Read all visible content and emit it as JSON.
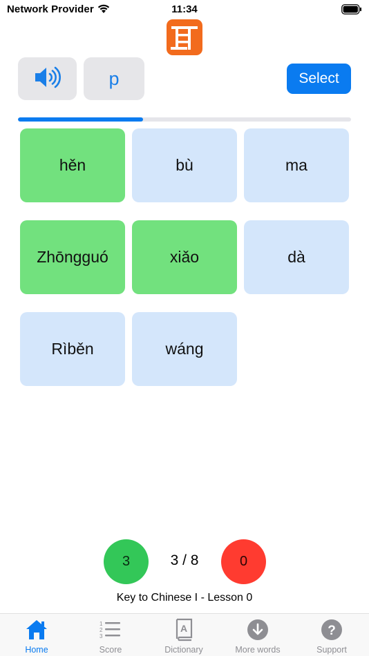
{
  "status_bar": {
    "carrier": "Network Provider",
    "time": "11:34"
  },
  "controls": {
    "sound_icon": "speaker-icon",
    "letter": "p",
    "select_label": "Select"
  },
  "progress": {
    "fraction": 0.375
  },
  "tiles": [
    {
      "label": "hěn",
      "state": "correct"
    },
    {
      "label": "bù",
      "state": "pending"
    },
    {
      "label": "ma",
      "state": "pending"
    },
    {
      "label": "Zhōngguó",
      "state": "correct"
    },
    {
      "label": "xiǎo",
      "state": "correct"
    },
    {
      "label": "dà",
      "state": "pending"
    },
    {
      "label": "Rìběn",
      "state": "pending"
    },
    {
      "label": "wáng",
      "state": "pending"
    }
  ],
  "score": {
    "correct": "3",
    "progress": "3 / 8",
    "wrong": "0"
  },
  "lesson_title": "Key to Chinese I - Lesson 0",
  "tab_bar": {
    "tabs": [
      {
        "label": "Home",
        "icon": "home-icon",
        "active": true
      },
      {
        "label": "Score",
        "icon": "list-icon",
        "active": false
      },
      {
        "label": "Dictionary",
        "icon": "dictionary-icon",
        "active": false
      },
      {
        "label": "More words",
        "icon": "download-icon",
        "active": false
      },
      {
        "label": "Support",
        "icon": "question-icon",
        "active": false
      }
    ]
  },
  "colors": {
    "accent": "#0a7bf0",
    "correct_tile": "#72e17e",
    "pending_tile": "#d4e6fb",
    "score_correct": "#33c758",
    "score_wrong": "#ff3b30",
    "logo": "#f26b1d"
  }
}
